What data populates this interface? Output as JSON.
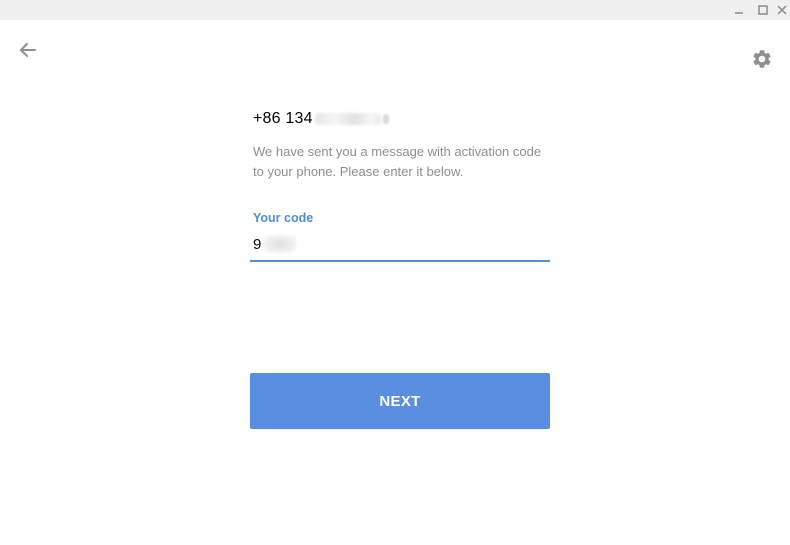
{
  "window": {
    "controls": {
      "minimize_glyph": "—",
      "maximize_glyph": "☐",
      "close_glyph": "✕"
    }
  },
  "header": {
    "back_icon": "arrow-left-icon",
    "settings_icon": "gear-icon"
  },
  "phone": {
    "visible_prefix": "+86 134",
    "visible_suffix": "3"
  },
  "description": "We have sent you a message with activation code to your phone. Please enter it below.",
  "code_field": {
    "label": "Your code",
    "visible_value": "9"
  },
  "next_button": {
    "label": "NEXT"
  },
  "colors": {
    "accent": "#4f8fcf",
    "button": "#5a8fe0",
    "muted_text": "#8e8e8e",
    "titlebar": "#f0f0f0"
  }
}
